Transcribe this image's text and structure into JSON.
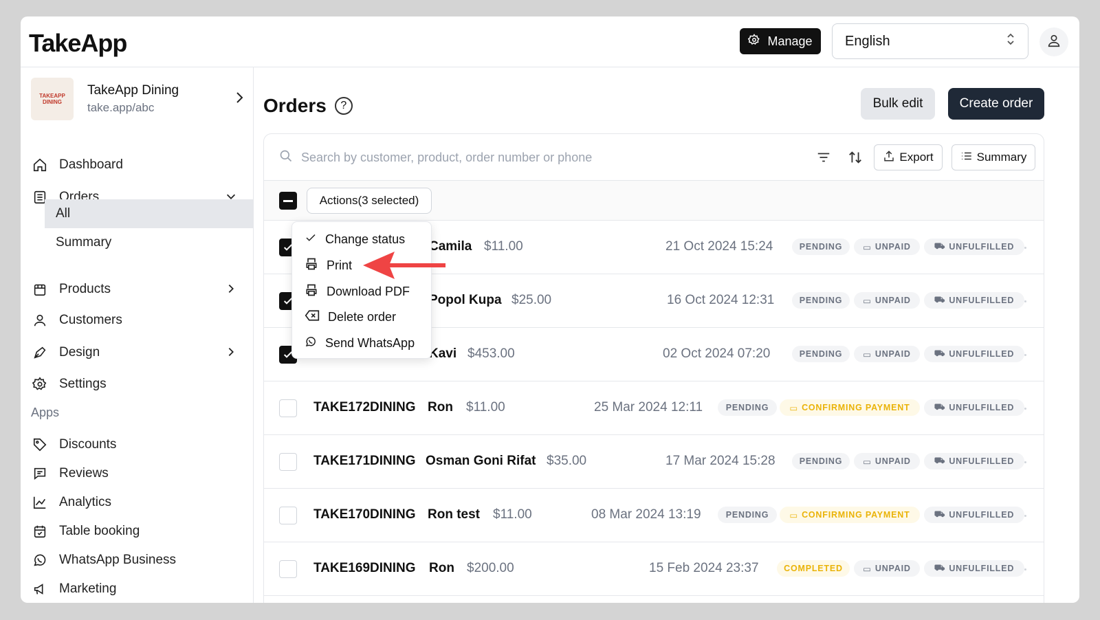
{
  "app": {
    "logo": "TakeApp"
  },
  "header": {
    "manage_label": "Manage",
    "language": "English"
  },
  "store": {
    "name": "TakeApp Dining",
    "url": "take.app/abc",
    "logo_text": "TAKEAPP DINING"
  },
  "sidebar": {
    "dashboard": "Dashboard",
    "orders": "Orders",
    "orders_all": "All",
    "orders_summary": "Summary",
    "products": "Products",
    "customers": "Customers",
    "design": "Design",
    "settings": "Settings",
    "apps_label": "Apps",
    "discounts": "Discounts",
    "reviews": "Reviews",
    "analytics": "Analytics",
    "table_booking": "Table booking",
    "whatsapp_business": "WhatsApp Business",
    "marketing": "Marketing"
  },
  "main": {
    "title": "Orders",
    "help": "?",
    "bulk_edit": "Bulk edit",
    "create_order": "Create order",
    "search_placeholder": "Search by customer, product, order number or phone",
    "export": "Export",
    "summary": "Summary",
    "actions": "Actions(3 selected)"
  },
  "dropdown": {
    "change_status": "Change status",
    "print": "Print",
    "download_pdf": "Download PDF",
    "delete_order": "Delete order",
    "send_whatsapp": "Send WhatsApp"
  },
  "orders": [
    {
      "customer": "Camila",
      "total": "$11.00",
      "date": "21 Oct 2024 15:24",
      "status": "PENDING",
      "payment": "UNPAID",
      "fulfillment": "UNFULFILLED"
    },
    {
      "customer": "Popol Kupa",
      "total": "$25.00",
      "date": "16 Oct 2024 12:31",
      "status": "PENDING",
      "payment": "UNPAID",
      "fulfillment": "UNFULFILLED"
    },
    {
      "customer": "Kavi",
      "total": "$453.00",
      "date": "02 Oct 2024 07:20",
      "status": "PENDING",
      "payment": "UNPAID",
      "fulfillment": "UNFULFILLED"
    },
    {
      "order_no": "TAKE172DINING",
      "customer": "Ron",
      "total": "$11.00",
      "date": "25 Mar 2024 12:11",
      "status": "PENDING",
      "payment": "CONFIRMING PAYMENT",
      "fulfillment": "UNFULFILLED"
    },
    {
      "order_no": "TAKE171DINING",
      "customer": "Osman Goni Rifat",
      "total": "$35.00",
      "date": "17 Mar 2024 15:28",
      "status": "PENDING",
      "payment": "UNPAID",
      "fulfillment": "UNFULFILLED"
    },
    {
      "order_no": "TAKE170DINING",
      "customer": "Ron test",
      "total": "$11.00",
      "date": "08 Mar 2024 13:19",
      "status": "PENDING",
      "payment": "CONFIRMING PAYMENT",
      "fulfillment": "UNFULFILLED"
    },
    {
      "order_no": "TAKE169DINING",
      "customer": "Ron",
      "total": "$200.00",
      "date": "15 Feb 2024 23:37",
      "status": "COMPLETED",
      "payment": "UNPAID",
      "fulfillment": "UNFULFILLED"
    }
  ],
  "colors": {
    "accent": "#111111",
    "amber": "#eab308",
    "arrow": "#ef4444"
  }
}
